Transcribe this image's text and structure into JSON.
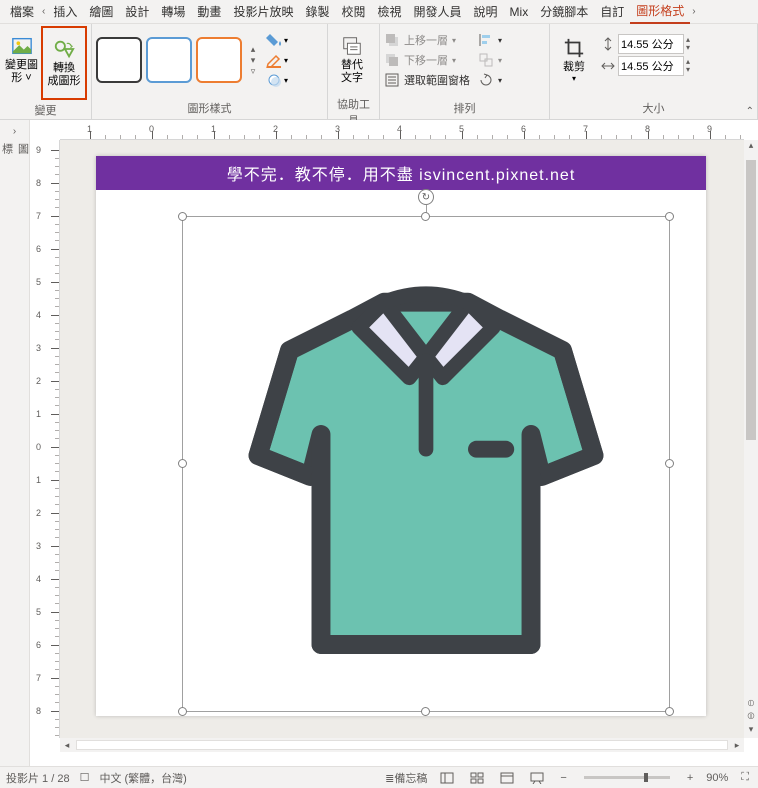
{
  "tabs": {
    "file": "檔案",
    "arrow_left": "‹",
    "insert": "插入",
    "draw": "繪圖",
    "design": "設計",
    "transition": "轉場",
    "animation": "動畫",
    "slideshow": "投影片放映",
    "record": "錄製",
    "review": "校閱",
    "view": "檢視",
    "developer": "開發人員",
    "help": "說明",
    "mix": "Mix",
    "storyboard": "分鏡腳本",
    "custom": "自訂",
    "graphic_format": "圖形格式",
    "arrow_right": "›"
  },
  "ribbon": {
    "change_group": {
      "change_graphic": "變更圖\n形 ˅",
      "convert_shape": "轉換\n成圖形",
      "label": "變更"
    },
    "style_group": {
      "label": "圖形樣式"
    },
    "a11y_group": {
      "alt_text": "替代\n文字",
      "label": "協助工具"
    },
    "arrange_group": {
      "bring_forward": "上移一層",
      "send_backward": "下移一層",
      "selection_pane": "選取範圍窗格",
      "label": "排列"
    },
    "size_group": {
      "crop": "裁剪",
      "height_value": "14.55 公分",
      "width_value": "14.55 公分",
      "label": "大小"
    }
  },
  "side": {
    "label": "圖\n標"
  },
  "slide": {
    "banner": "學不完．教不停．用不盡 isvincent.pixnet.net"
  },
  "status": {
    "slide_no": "投影片 1 / 28",
    "lang": "中文 (繁體，台灣)",
    "notes": "備忘稿",
    "zoom": "90%"
  },
  "ruler_h": [
    "1",
    "0",
    "1",
    "2",
    "3",
    "4",
    "5",
    "6",
    "7",
    "8",
    "9"
  ],
  "ruler_v": [
    "9",
    "8",
    "7",
    "6",
    "5",
    "4",
    "3",
    "2",
    "1",
    "0",
    "1",
    "2",
    "3",
    "4",
    "5",
    "6",
    "7",
    "8"
  ]
}
